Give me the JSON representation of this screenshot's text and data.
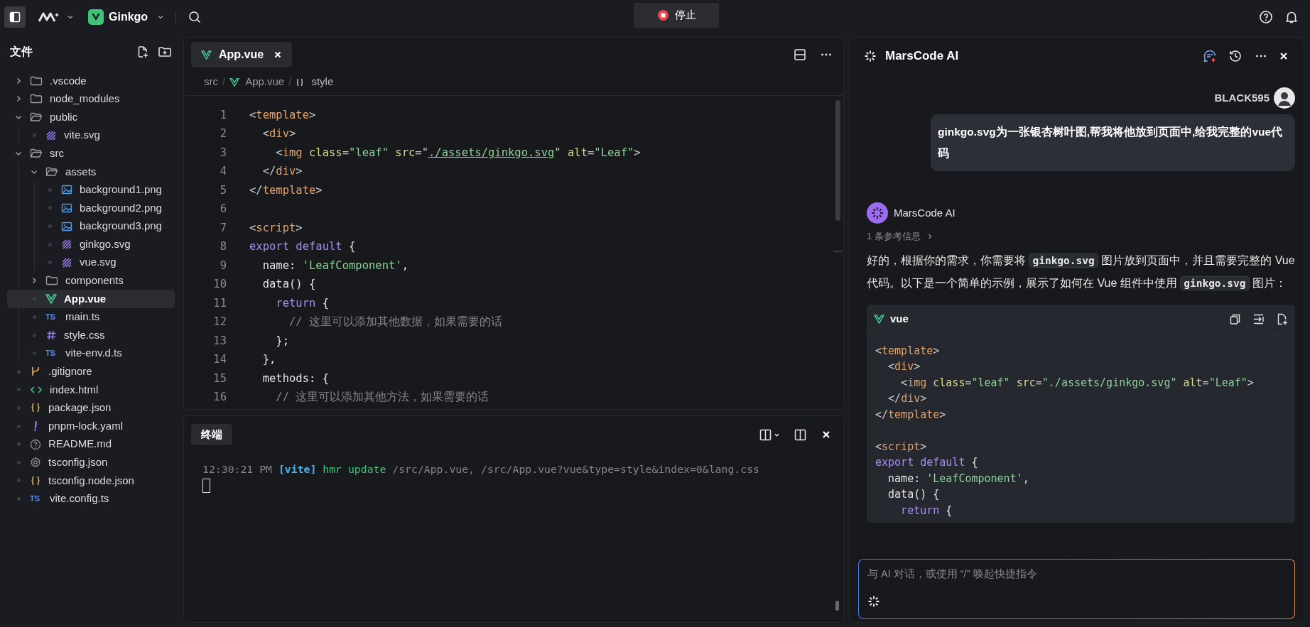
{
  "top_bar": {
    "project": "Ginkgo",
    "stop_button": "停止"
  },
  "sidebar": {
    "title": "文件",
    "tree": [
      {
        "name": ".vscode",
        "kind": "folder",
        "expanded": false,
        "selected": false
      },
      {
        "name": "node_modules",
        "kind": "folder",
        "expanded": false,
        "selected": false
      },
      {
        "name": "public",
        "kind": "folder",
        "expanded": true,
        "selected": false,
        "children": [
          {
            "name": "vite.svg",
            "kind": "svg",
            "selected": false
          }
        ]
      },
      {
        "name": "src",
        "kind": "folder",
        "expanded": true,
        "selected": false,
        "children": [
          {
            "name": "assets",
            "kind": "folder",
            "expanded": true,
            "selected": false,
            "children": [
              {
                "name": "background1.png",
                "kind": "image",
                "selected": false
              },
              {
                "name": "background2.png",
                "kind": "image",
                "selected": false
              },
              {
                "name": "background3.png",
                "kind": "image",
                "selected": false
              },
              {
                "name": "ginkgo.svg",
                "kind": "svg",
                "selected": false
              },
              {
                "name": "vue.svg",
                "kind": "svg",
                "selected": false
              }
            ]
          },
          {
            "name": "components",
            "kind": "folder",
            "expanded": false,
            "selected": false
          },
          {
            "name": "App.vue",
            "kind": "vue",
            "selected": true
          },
          {
            "name": "main.ts",
            "kind": "ts",
            "icon_label": "TS",
            "selected": false
          },
          {
            "name": "style.css",
            "kind": "css",
            "selected": false
          },
          {
            "name": "vite-env.d.ts",
            "kind": "ts",
            "icon_label": "TS",
            "selected": false
          }
        ]
      },
      {
        "name": ".gitignore",
        "kind": "git",
        "selected": false
      },
      {
        "name": "index.html",
        "kind": "html",
        "selected": false
      },
      {
        "name": "package.json",
        "kind": "json",
        "selected": false
      },
      {
        "name": "pnpm-lock.yaml",
        "kind": "yaml",
        "selected": false
      },
      {
        "name": "README.md",
        "kind": "md",
        "selected": false
      },
      {
        "name": "tsconfig.json",
        "kind": "config",
        "selected": false
      },
      {
        "name": "tsconfig.node.json",
        "kind": "json",
        "selected": false
      },
      {
        "name": "vite.config.ts",
        "kind": "ts",
        "icon_label": "TS",
        "selected": false
      }
    ]
  },
  "editor": {
    "tabs": [
      {
        "label": "App.vue",
        "selected": true
      }
    ],
    "breadcrumb": [
      {
        "kind": "folder",
        "text": "src"
      },
      {
        "kind": "separator",
        "text": "/"
      },
      {
        "kind": "vue",
        "text": "App.vue"
      },
      {
        "kind": "separator",
        "text": "/"
      },
      {
        "kind": "block",
        "text": "style"
      }
    ],
    "lines": [
      {
        "number": "1",
        "tokens": [
          {
            "text": "<",
            "kind": "punct"
          },
          {
            "text": "template",
            "kind": "tag"
          },
          {
            "text": ">",
            "kind": "punct"
          }
        ]
      },
      {
        "number": "2",
        "tokens": [
          {
            "text": "  <",
            "kind": "punct"
          },
          {
            "text": "div",
            "kind": "tag"
          },
          {
            "text": ">",
            "kind": "punct"
          }
        ]
      },
      {
        "number": "3",
        "tokens": [
          {
            "text": "    <",
            "kind": "punct"
          },
          {
            "text": "img",
            "kind": "tag"
          },
          {
            "text": " class",
            "kind": "attr"
          },
          {
            "text": "=",
            "kind": "punct"
          },
          {
            "text": "\"leaf\"",
            "kind": "string"
          },
          {
            "text": " src",
            "kind": "attr"
          },
          {
            "text": "=\"",
            "kind": "punct"
          },
          {
            "text": "./assets/ginkgo.svg",
            "kind": "link"
          },
          {
            "text": "\"",
            "kind": "punct"
          },
          {
            "text": " alt",
            "kind": "attr"
          },
          {
            "text": "=",
            "kind": "punct"
          },
          {
            "text": "\"Leaf\"",
            "kind": "string"
          },
          {
            "text": ">",
            "kind": "punct"
          }
        ]
      },
      {
        "number": "4",
        "tokens": [
          {
            "text": "  </",
            "kind": "punct"
          },
          {
            "text": "div",
            "kind": "tag"
          },
          {
            "text": ">",
            "kind": "punct"
          }
        ]
      },
      {
        "number": "5",
        "tokens": [
          {
            "text": "</",
            "kind": "punct"
          },
          {
            "text": "template",
            "kind": "tag"
          },
          {
            "text": ">",
            "kind": "punct"
          }
        ]
      },
      {
        "number": "6"
      },
      {
        "number": "7",
        "tokens": [
          {
            "text": "<",
            "kind": "punct"
          },
          {
            "text": "script",
            "kind": "tag"
          },
          {
            "text": ">",
            "kind": "punct"
          }
        ]
      },
      {
        "number": "8",
        "tokens": [
          {
            "text": "export default",
            "kind": "keyword"
          },
          {
            "text": " {",
            "kind": "text"
          }
        ]
      },
      {
        "number": "9",
        "tokens": [
          {
            "text": "  name: ",
            "kind": "text"
          },
          {
            "text": "'LeafComponent'",
            "kind": "string"
          },
          {
            "text": ",",
            "kind": "text"
          }
        ]
      },
      {
        "number": "10",
        "tokens": [
          {
            "text": "  data() {",
            "kind": "text"
          }
        ]
      },
      {
        "number": "11",
        "tokens": [
          {
            "text": "    return",
            "kind": "keyword"
          },
          {
            "text": " {",
            "kind": "text"
          }
        ]
      },
      {
        "number": "12",
        "tokens": [
          {
            "text": "      // 这里可以添加其他数据，如果需要的话",
            "kind": "comment"
          }
        ]
      },
      {
        "number": "13",
        "tokens": [
          {
            "text": "    };",
            "kind": "text"
          }
        ]
      },
      {
        "number": "14",
        "tokens": [
          {
            "text": "  },",
            "kind": "text"
          }
        ]
      },
      {
        "number": "15",
        "tokens": [
          {
            "text": "  methods: {",
            "kind": "text"
          }
        ]
      },
      {
        "number": "16",
        "tokens": [
          {
            "text": "    // 这里可以添加其他方法，如果需要的话",
            "kind": "comment"
          }
        ]
      }
    ]
  },
  "terminal": {
    "tabs": [
      {
        "label": "终端",
        "selected": true
      }
    ],
    "lines": [
      {
        "tokens": [
          {
            "text": "12:30:21 PM ",
            "kind": "comment"
          },
          {
            "text": "[vite]",
            "kind": "label"
          },
          {
            "text": " hmr update ",
            "kind": "success"
          },
          {
            "text": "/src/App.vue, /src/App.vue?vue&type=style&index=0&lang.css",
            "kind": "comment"
          }
        ]
      }
    ]
  },
  "assistant": {
    "title": "MarsCode AI",
    "messages": [
      {
        "kind": "user",
        "author": "BLACK595",
        "text": "ginkgo.svg为一张银杏树叶图,帮我将他放到页面中,给我完整的vue代码"
      },
      {
        "kind": "assistant",
        "author": "MarsCode AI",
        "references": "1 条参考信息",
        "paragraph": [
          {
            "kind": "text",
            "text": "好的，根据你的需求，你需要将 "
          },
          {
            "kind": "code",
            "text": "ginkgo.svg"
          },
          {
            "kind": "text",
            "text": " 图片放到页面中，并且需要完整的 Vue 代码。以下是一个简单的示例，展示了如何在 Vue 组件中使用 "
          },
          {
            "kind": "code",
            "text": "ginkgo.svg"
          },
          {
            "kind": "text",
            "text": " 图片："
          }
        ],
        "code_block": {
          "language": "vue",
          "lines": [
            {
              "kind": "code",
              "tokens": [
                {
                  "text": "<",
                  "kind": "punct"
                },
                {
                  "text": "template",
                  "kind": "tag"
                },
                {
                  "text": ">",
                  "kind": "punct"
                }
              ]
            },
            {
              "kind": "code",
              "tokens": [
                {
                  "text": "  <",
                  "kind": "punct"
                },
                {
                  "text": "div",
                  "kind": "tag"
                },
                {
                  "text": ">",
                  "kind": "punct"
                }
              ]
            },
            {
              "kind": "code",
              "tokens": [
                {
                  "text": "    <",
                  "kind": "punct"
                },
                {
                  "text": "img",
                  "kind": "tag"
                },
                {
                  "text": " class",
                  "kind": "attr"
                },
                {
                  "text": "=",
                  "kind": "punct"
                },
                {
                  "text": "\"leaf\"",
                  "kind": "string"
                },
                {
                  "text": " src",
                  "kind": "attr"
                },
                {
                  "text": "=",
                  "kind": "punct"
                },
                {
                  "text": "\"./assets/ginkgo.svg\"",
                  "kind": "string"
                },
                {
                  "text": " alt",
                  "kind": "attr"
                },
                {
                  "text": "=",
                  "kind": "punct"
                },
                {
                  "text": "\"Leaf\"",
                  "kind": "string"
                },
                {
                  "text": ">",
                  "kind": "punct"
                }
              ]
            },
            {
              "kind": "code",
              "tokens": [
                {
                  "text": "  </",
                  "kind": "punct"
                },
                {
                  "text": "div",
                  "kind": "tag"
                },
                {
                  "text": ">",
                  "kind": "punct"
                }
              ]
            },
            {
              "kind": "code",
              "tokens": [
                {
                  "text": "</",
                  "kind": "punct"
                },
                {
                  "text": "template",
                  "kind": "tag"
                },
                {
                  "text": ">",
                  "kind": "punct"
                }
              ]
            },
            {
              "kind": "blank"
            },
            {
              "kind": "code",
              "tokens": [
                {
                  "text": "<",
                  "kind": "punct"
                },
                {
                  "text": "script",
                  "kind": "tag"
                },
                {
                  "text": ">",
                  "kind": "punct"
                }
              ]
            },
            {
              "kind": "code",
              "tokens": [
                {
                  "text": "export default",
                  "kind": "keyword"
                },
                {
                  "text": " {",
                  "kind": "text"
                }
              ]
            },
            {
              "kind": "code",
              "tokens": [
                {
                  "text": "  name: ",
                  "kind": "text"
                },
                {
                  "text": "'LeafComponent'",
                  "kind": "string"
                },
                {
                  "text": ",",
                  "kind": "text"
                }
              ]
            },
            {
              "kind": "code",
              "tokens": [
                {
                  "text": "  data() {",
                  "kind": "text"
                }
              ]
            },
            {
              "kind": "code",
              "tokens": [
                {
                  "text": "    return",
                  "kind": "keyword"
                },
                {
                  "text": " {",
                  "kind": "text"
                }
              ]
            }
          ]
        }
      }
    ],
    "input": {
      "placeholder": "与 AI 对话，或使用 “/” 唤起快捷指令"
    }
  }
}
